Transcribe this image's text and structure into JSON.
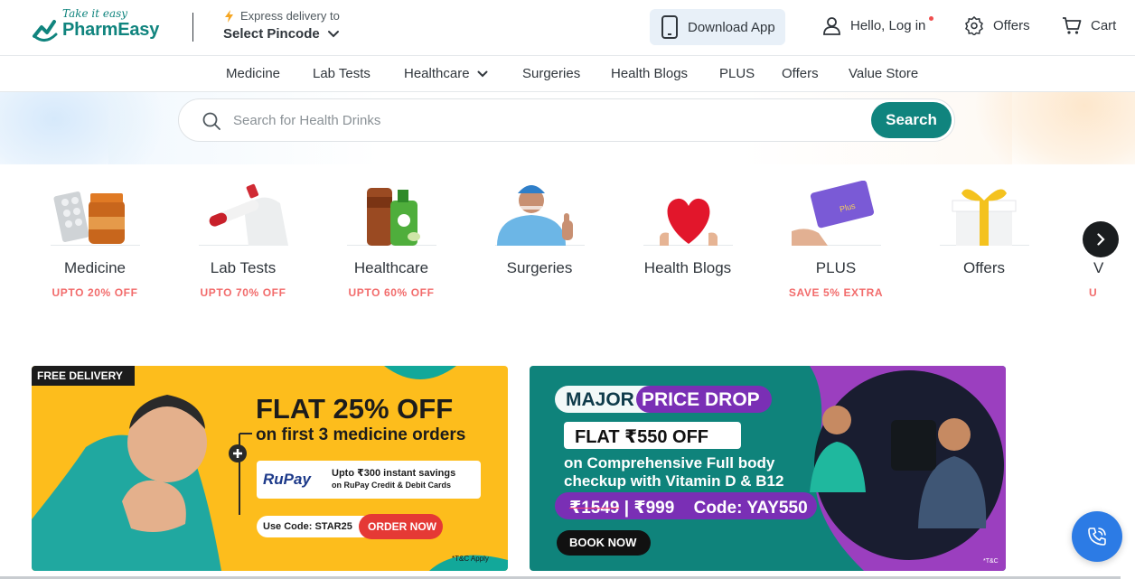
{
  "header": {
    "logo_tagline": "Take it easy",
    "logo_name": "PharmEasy",
    "delivery_label": "Express delivery to",
    "pincode_label": "Select Pincode",
    "download_app_label": "Download App",
    "login_label": "Hello, Log in",
    "offers_label": "Offers",
    "cart_label": "Cart"
  },
  "nav": {
    "items": [
      {
        "label": "Medicine"
      },
      {
        "label": "Lab Tests"
      },
      {
        "label": "Healthcare",
        "has_dropdown": true
      },
      {
        "label": "Surgeries"
      },
      {
        "label": "Health Blogs"
      },
      {
        "label": "PLUS"
      },
      {
        "label": "Offers"
      },
      {
        "label": "Value Store"
      }
    ]
  },
  "search": {
    "placeholder": "Search for Health Drinks",
    "button_label": "Search"
  },
  "categories": [
    {
      "label": "Medicine",
      "offer": "UPTO 20% OFF",
      "icon": "medicine-pills"
    },
    {
      "label": "Lab Tests",
      "offer": "UPTO 70% OFF",
      "icon": "test-tube"
    },
    {
      "label": "Healthcare",
      "offer": "UPTO 60% OFF",
      "icon": "healthcare-products"
    },
    {
      "label": "Surgeries",
      "offer": "",
      "icon": "surgeon"
    },
    {
      "label": "Health Blogs",
      "offer": "",
      "icon": "heart"
    },
    {
      "label": "PLUS",
      "offer": "SAVE 5% EXTRA",
      "icon": "plus-card"
    },
    {
      "label": "Offers",
      "offer": "",
      "icon": "gift-box"
    },
    {
      "label": "V",
      "offer": "U",
      "icon": "value-store"
    }
  ],
  "banners": [
    {
      "badge": "FREE DELIVERY",
      "headline": "FLAT 25% OFF",
      "subline": "on first 3 medicine orders",
      "card_brand": "RuPay",
      "card_offer_1": "Upto ₹300 instant savings",
      "card_offer_2": "on RuPay Credit & Debit Cards",
      "code_label": "Use Code:",
      "code": "STAR25",
      "cta": "ORDER NOW",
      "tnc": "*T&C Apply"
    },
    {
      "pill_1": "MAJOR",
      "pill_2": "PRICE DROP",
      "headline": "FLAT ₹550 OFF",
      "sub_1": "on Comprehensive Full body",
      "sub_2": "checkup with Vitamin D & B12",
      "old_price": "₹1549",
      "separator": "|",
      "new_price": "₹999",
      "code_text": "Code: YAY550",
      "cta": "BOOK NOW",
      "tnc": "*T&C"
    }
  ],
  "colors": {
    "brand": "#10847e",
    "offer_red": "#f26c6c",
    "banner1_bg": "#fdbd1c",
    "banner2_bg": "#0f837b",
    "fab_blue": "#2c7be5"
  }
}
